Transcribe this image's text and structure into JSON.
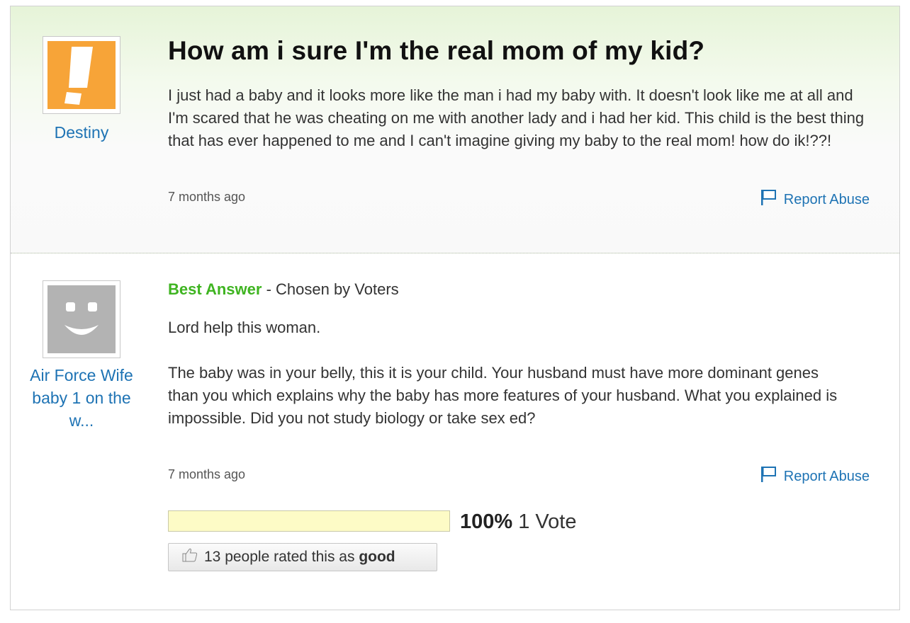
{
  "question": {
    "asker_name": "Destiny",
    "title": "How am i sure I'm the real mom of my kid?",
    "body": "I just had a baby and it looks more like the man i had my baby with. It doesn't look like me at all and I'm scared that he was cheating on me with another lady and i had her kid. This child is the best thing that has ever happened to me and I can't imagine giving my baby to the real mom! how do ik!??!",
    "timestamp": "7 months ago",
    "report_label": "Report Abuse",
    "avatar_icon": "exclamation-avatar-icon",
    "avatar_color": "#f7a438"
  },
  "answer": {
    "answerer_name": "Air Force Wife baby 1 on the w...",
    "best_label": "Best Answer",
    "chosen_by": " - Chosen by Voters",
    "paragraph1": "Lord help this woman.",
    "paragraph2": "The baby was in your belly, this it is your child. Your husband must have more dominant genes than you which explains why the baby has more features of your husband. What you explained is impossible. Did you not study biology or take sex ed?",
    "timestamp": "7 months ago",
    "report_label": "Report Abuse",
    "avatar_icon": "smiley-avatar-icon",
    "avatar_color": "#b3b3b3",
    "vote_percent_label": "100%",
    "vote_fraction": 1.0,
    "vote_count_label": "1 Vote",
    "rating_prefix": "13 people rated this as",
    "rating_word": "good"
  },
  "colors": {
    "link": "#1e73b4",
    "best_answer": "#3fb421",
    "vote_fill": "#fdfbc6"
  }
}
